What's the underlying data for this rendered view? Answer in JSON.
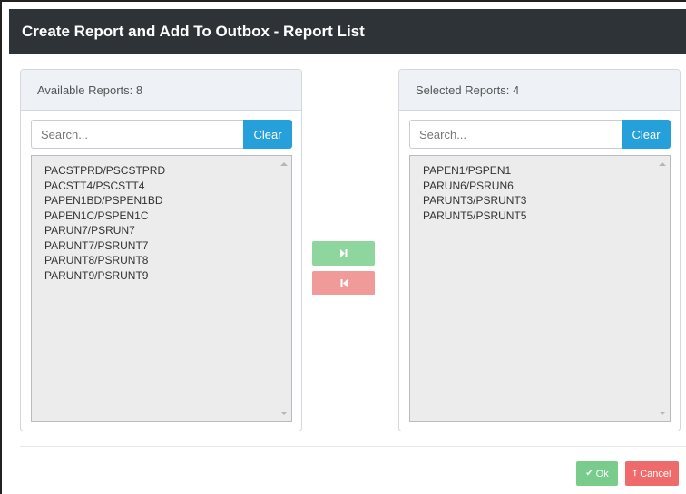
{
  "dialog": {
    "title": "Create Report and Add To Outbox - Report List"
  },
  "available": {
    "header": "Available Reports: 8",
    "search_placeholder": "Search...",
    "clear_label": "Clear",
    "items": [
      "PACSTPRD/PSCSTPRD",
      "PACSTT4/PSCSTT4",
      "PAPEN1BD/PSPEN1BD",
      "PAPEN1C/PSPEN1C",
      "PARUN7/PSRUN7",
      "PARUNT7/PSRUNT7",
      "PARUNT8/PSRUNT8",
      "PARUNT9/PSRUNT9"
    ]
  },
  "selected": {
    "header": "Selected Reports: 4",
    "search_placeholder": "Search...",
    "clear_label": "Clear",
    "items": [
      "PAPEN1/PSPEN1",
      "PARUN6/PSRUN6",
      "PARUNT3/PSRUNT3",
      "PARUNT5/PSRUNT5"
    ]
  },
  "transfer": {
    "move_right_icon": "step-forward-icon",
    "move_left_icon": "step-backward-icon",
    "move_right_color": "#8fd69e",
    "move_left_color": "#f19a9a"
  },
  "footer": {
    "ok_label": "Ok",
    "ok_icon": "check-icon",
    "cancel_label": "Cancel",
    "cancel_icon": "upload-icon",
    "ok_color": "#79cc8c",
    "cancel_color": "#ef6b6b"
  },
  "colors": {
    "title_bar": "#2e3338",
    "clear_button": "#26a0da",
    "list_background": "#ececec",
    "panel_header": "#eef1f5"
  }
}
